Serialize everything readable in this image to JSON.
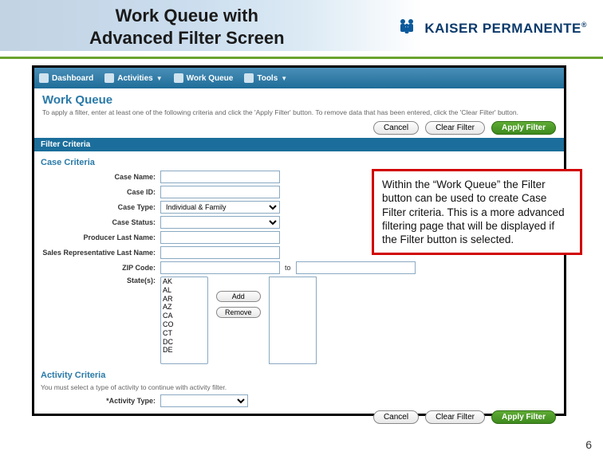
{
  "slide": {
    "title_l1": "Work Queue  with",
    "title_l2": "Advanced Filter Screen",
    "page_number": "6"
  },
  "brand": {
    "name": "KAISER PERMANENTE"
  },
  "nav": {
    "dashboard": "Dashboard",
    "activities": "Activities",
    "work_queue": "Work Queue",
    "tools": "Tools"
  },
  "page": {
    "title": "Work Queue",
    "desc": "To apply a filter, enter at least one of the following criteria and click the 'Apply Filter' button. To remove data that has been entered, click the 'Clear Filter' button."
  },
  "buttons": {
    "cancel": "Cancel",
    "clear": "Clear Filter",
    "apply": "Apply Filter",
    "add": "Add",
    "remove": "Remove"
  },
  "sections": {
    "filter_criteria": "Filter Criteria",
    "case_criteria": "Case Criteria",
    "activity_criteria": "Activity Criteria"
  },
  "labels": {
    "case_name": "Case Name:",
    "case_id": "Case ID:",
    "case_type": "Case Type:",
    "case_status": "Case Status:",
    "producer_last": "Producer Last Name:",
    "sales_rep_last": "Sales Representative Last Name:",
    "zip": "ZIP Code:",
    "to": "to",
    "states": "State(s):",
    "activity_type": "*Activity Type:"
  },
  "case_type_value": "Individual & Family",
  "states": [
    "AK",
    "AL",
    "AR",
    "AZ",
    "CA",
    "CO",
    "CT",
    "DC",
    "DE"
  ],
  "activity_note": "You must select a type of activity to continue with activity filter.",
  "callout": "Within the “Work Queue” the Filter button can be used to create Case Filter criteria. This is a more advanced filtering page that will be displayed if the Filter button is selected."
}
